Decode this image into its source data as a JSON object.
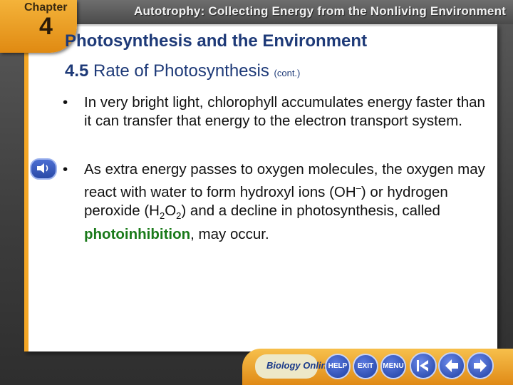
{
  "header": {
    "chapter_label": "Chapter",
    "chapter_number": "4",
    "title": "Autotrophy: Collecting Energy from the Nonliving Environment"
  },
  "slide": {
    "title": "Photosynthesis and the Environment",
    "section_number": "4.5",
    "section_title": "Rate of Photosynthesis",
    "section_cont": "(cont.)",
    "bullet_marker": "•",
    "bullet1": "In very bright light, chlorophyll accumulates energy faster than it can transfer that energy to the electron transport system.",
    "bullet2": {
      "part1": "As extra energy passes to oxygen molecules, the oxygen may react with water to form hydroxyl ions (OH",
      "sup1": "–",
      "part2": ") or hydrogen peroxide (H",
      "sub1": "2",
      "part3": "O",
      "sub2": "2",
      "part4": ") and a decline in photosynthesis, called ",
      "term": "photoinhibition",
      "part5": ", may occur."
    }
  },
  "nav": {
    "logo_text": "Biology Online",
    "help_label": "HELP",
    "exit_label": "EXIT",
    "menu_label": "MENU",
    "icons": {
      "speaker": "speaker-icon",
      "first": "skip-back-icon",
      "prev": "arrow-left-icon",
      "next": "arrow-right-icon"
    }
  },
  "colors": {
    "accent": "#f3a626",
    "title": "#1e3a78",
    "term": "#1a7a1a",
    "button": "#1e3fa0"
  }
}
